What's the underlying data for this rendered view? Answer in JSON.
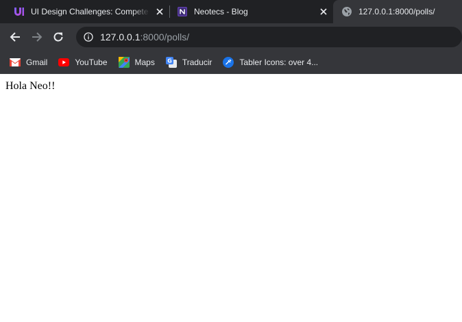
{
  "tabs": [
    {
      "title": "UI Design Challenges: Compete",
      "icon": "uxtools-logo-icon",
      "active": false
    },
    {
      "title": "Neotecs - Blog",
      "icon": "notion-logo-icon",
      "active": false
    },
    {
      "title": "127.0.0.1:8000/polls/",
      "icon": "globe-icon",
      "active": true
    }
  ],
  "toolbar": {
    "url_host": "127.0.0.1",
    "url_rest": ":8000/polls/"
  },
  "bookmarks": [
    {
      "label": "Gmail",
      "icon": "gmail-icon"
    },
    {
      "label": "YouTube",
      "icon": "youtube-icon"
    },
    {
      "label": "Maps",
      "icon": "maps-icon"
    },
    {
      "label": "Traducir",
      "icon": "google-translate-icon"
    },
    {
      "label": "Tabler Icons: over 4...",
      "icon": "tabler-icons-icon"
    }
  ],
  "page": {
    "text": "Hola Neo!!"
  },
  "colors": {
    "tabstrip_bg": "#202124",
    "toolbar_bg": "#35363a",
    "omnibox_bg": "#202124",
    "text": "#e8eaed",
    "muted_text": "#9aa0a6"
  }
}
